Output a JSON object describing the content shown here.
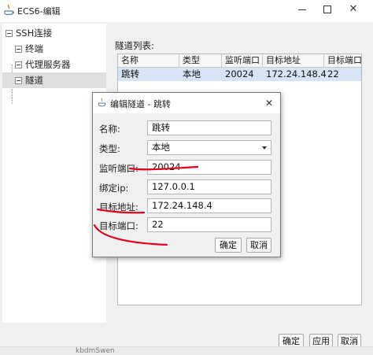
{
  "window": {
    "title": "ECS6-编辑"
  },
  "tree": {
    "root": "SSH连接",
    "children": [
      "终端",
      "代理服务器",
      "隧道"
    ]
  },
  "tunnels": {
    "label": "隧道列表:",
    "columns": [
      "名称",
      "类型",
      "监听端口",
      "目标地址",
      "目标端口"
    ],
    "rows": [
      [
        "跳转",
        "本地",
        "20024",
        "172.24.148.4",
        "22"
      ]
    ]
  },
  "dialog": {
    "title": "编辑隧道 - 跳转",
    "fields": {
      "name_label": "名称:",
      "name_value": "跳转",
      "type_label": "类型:",
      "type_value": "本地",
      "listen_port_label": "监听端口:",
      "listen_port_value": "20024",
      "bind_ip_label": "绑定ip:",
      "bind_ip_value": "127.0.0.1",
      "target_addr_label": "目标地址:",
      "target_addr_value": "172.24.148.4",
      "target_port_label": "目标端口:",
      "target_port_value": "22"
    },
    "buttons": {
      "ok": "确定",
      "cancel": "取消"
    }
  },
  "footer": {
    "ok": "确定",
    "apply": "应用",
    "cancel": "取消",
    "background_text": "kbdmSwen"
  },
  "colors": {
    "selection": "#d6e4f5",
    "annotation": "#e0001b"
  }
}
